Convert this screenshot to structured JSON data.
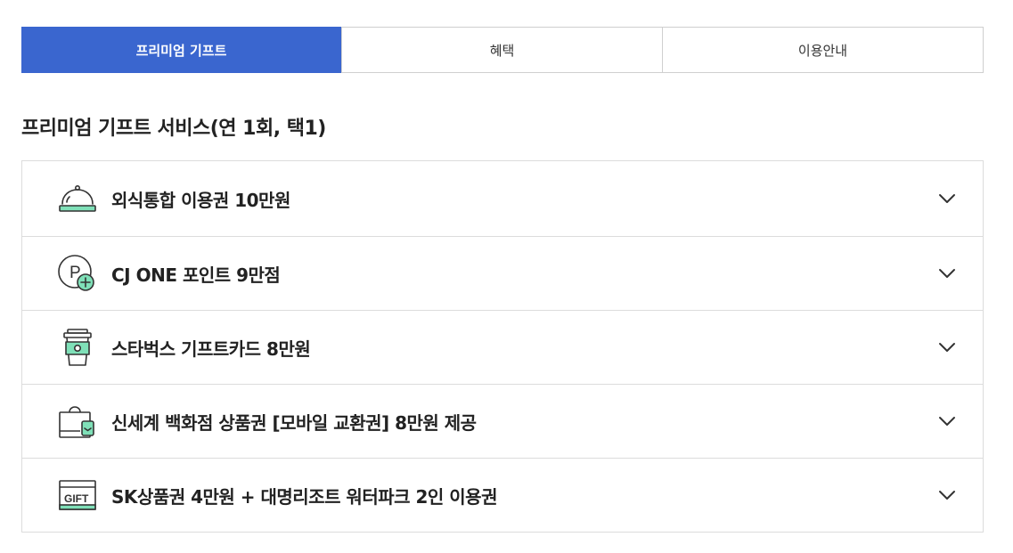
{
  "tabs": [
    {
      "label": "프리미엄 기프트",
      "active": true
    },
    {
      "label": "혜택",
      "active": false
    },
    {
      "label": "이용안내",
      "active": false
    }
  ],
  "section": {
    "title": "프리미엄 기프트 서비스(연 1회, 택1)"
  },
  "items": [
    {
      "label": "외식통합 이용권 10만원",
      "icon": "cloche-icon"
    },
    {
      "label": "CJ ONE 포인트 9만점",
      "icon": "point-plus-icon"
    },
    {
      "label": "스타벅스 기프트카드 8만원",
      "icon": "coffee-cup-icon"
    },
    {
      "label": "신세계 백화점 상품권 [모바일 교환권] 8만원 제공",
      "icon": "shopping-bag-icon"
    },
    {
      "label": "SK상품권 4만원 + 대명리조트 워터파크 2인 이용권",
      "icon": "gift-card-icon"
    }
  ],
  "icons": {
    "gift_text": "GIFT",
    "point_letter": "P"
  },
  "colors": {
    "accent": "#3a66cf",
    "mint": "#7fe0b8"
  }
}
